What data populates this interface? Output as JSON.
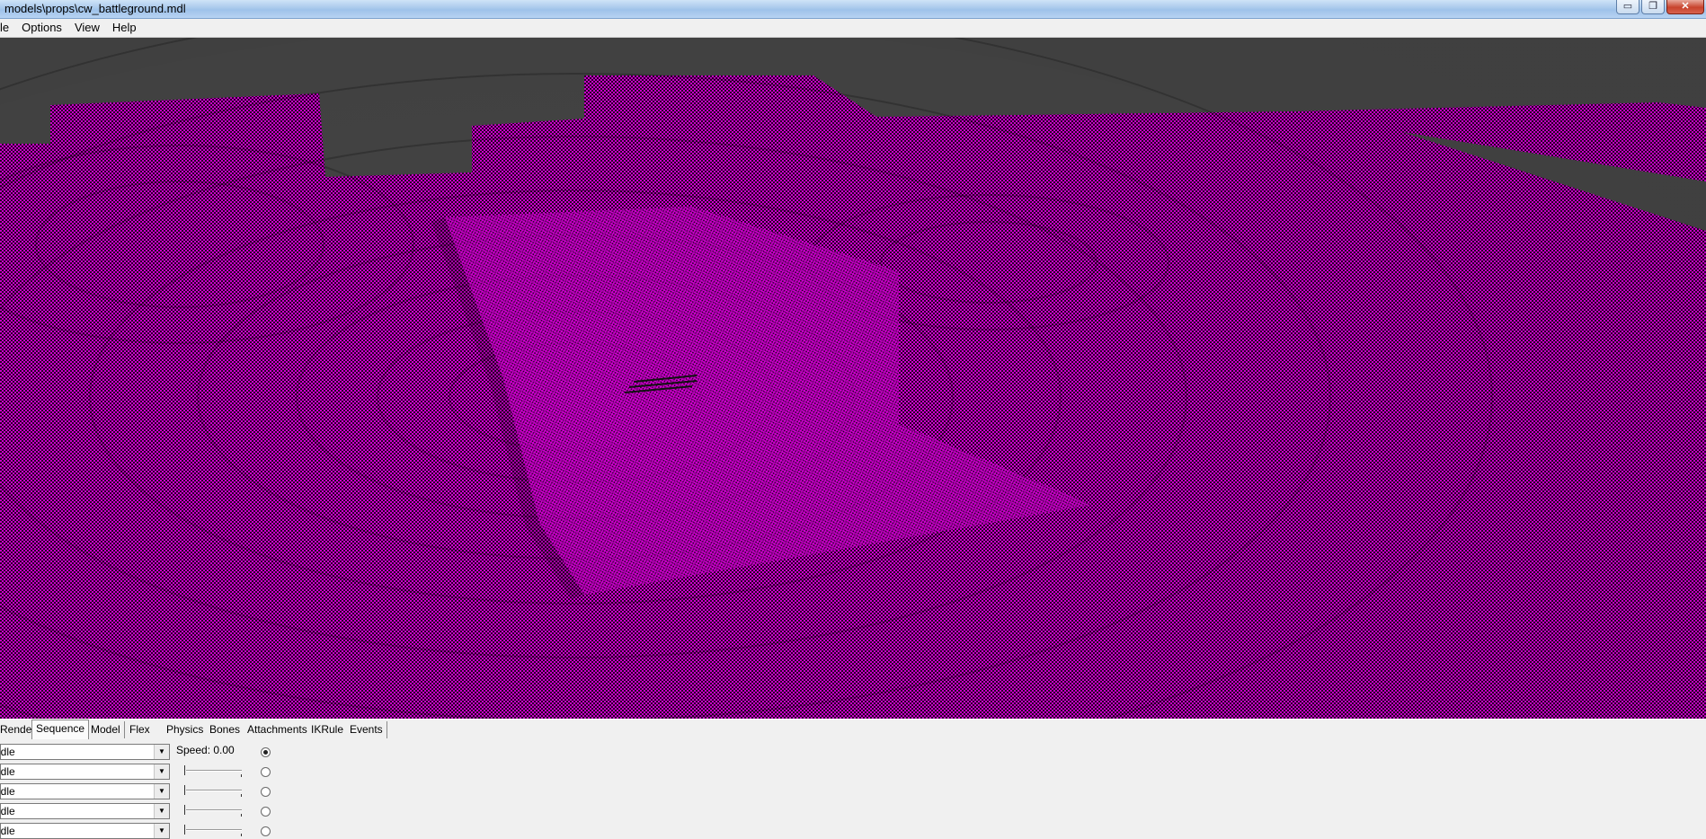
{
  "window": {
    "title": "models\\props\\cw_battleground.mdl",
    "buttons": {
      "minimize": "▭",
      "maximize": "❐",
      "close": "✕"
    }
  },
  "menu": [
    {
      "label": "le"
    },
    {
      "label": "Options"
    },
    {
      "label": "View"
    },
    {
      "label": "Help"
    }
  ],
  "viewport": {
    "background_color": "#454545",
    "texture_color": "#d400d4"
  },
  "tabs": [
    {
      "label": "Render"
    },
    {
      "label": "Sequence",
      "active": true
    },
    {
      "label": "Model"
    },
    {
      "label": "Flex"
    },
    {
      "label": "Physics"
    },
    {
      "label": "Bones"
    },
    {
      "label": "Attachments"
    },
    {
      "label": "IKRule"
    },
    {
      "label": "Events"
    }
  ],
  "sequence_panel": {
    "speed_label": "Speed: 0.00",
    "layers": [
      {
        "sequence": "idle",
        "selected": true
      },
      {
        "sequence": "idle",
        "selected": false
      },
      {
        "sequence": "idle",
        "selected": false
      },
      {
        "sequence": "idle",
        "selected": false
      },
      {
        "sequence": "idle",
        "selected": false
      }
    ]
  }
}
